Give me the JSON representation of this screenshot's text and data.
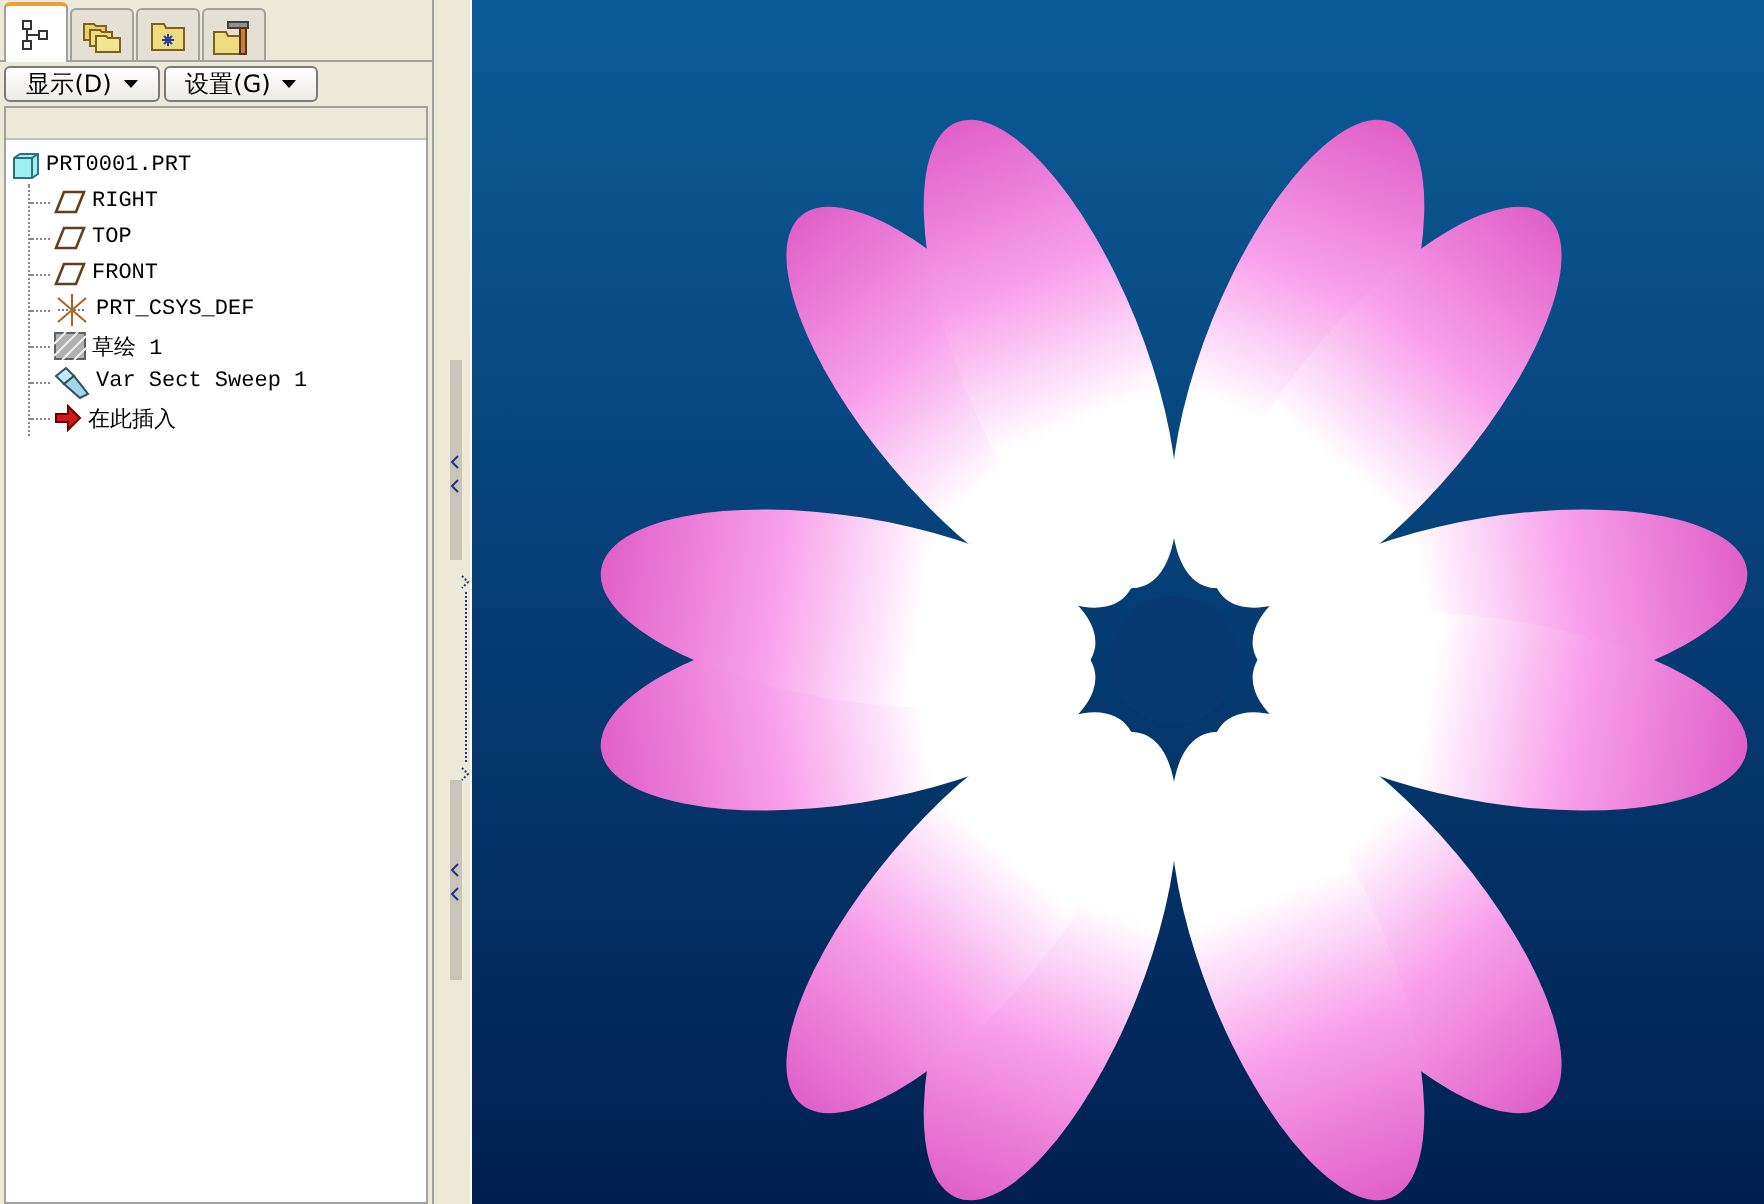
{
  "tabs": [
    {
      "kind": "tree",
      "selected": true
    },
    {
      "kind": "folders",
      "selected": false
    },
    {
      "kind": "favorites",
      "selected": false
    },
    {
      "kind": "tools",
      "selected": false
    }
  ],
  "menu_buttons": [
    {
      "label": "显示(D)"
    },
    {
      "label": "设置(G)"
    }
  ],
  "model_tree": [
    {
      "label": "PRT0001.PRT",
      "kind": "part",
      "children": [
        {
          "label": "RIGHT",
          "kind": "plane"
        },
        {
          "label": "TOP",
          "kind": "plane"
        },
        {
          "label": "FRONT",
          "kind": "plane"
        },
        {
          "label": "PRT_CSYS_DEF",
          "kind": "csys"
        },
        {
          "label": "草绘 1",
          "kind": "sketch"
        },
        {
          "label": "Var Sect Sweep 1",
          "kind": "sweep"
        },
        {
          "label": "在此插入",
          "kind": "insert"
        }
      ]
    }
  ]
}
